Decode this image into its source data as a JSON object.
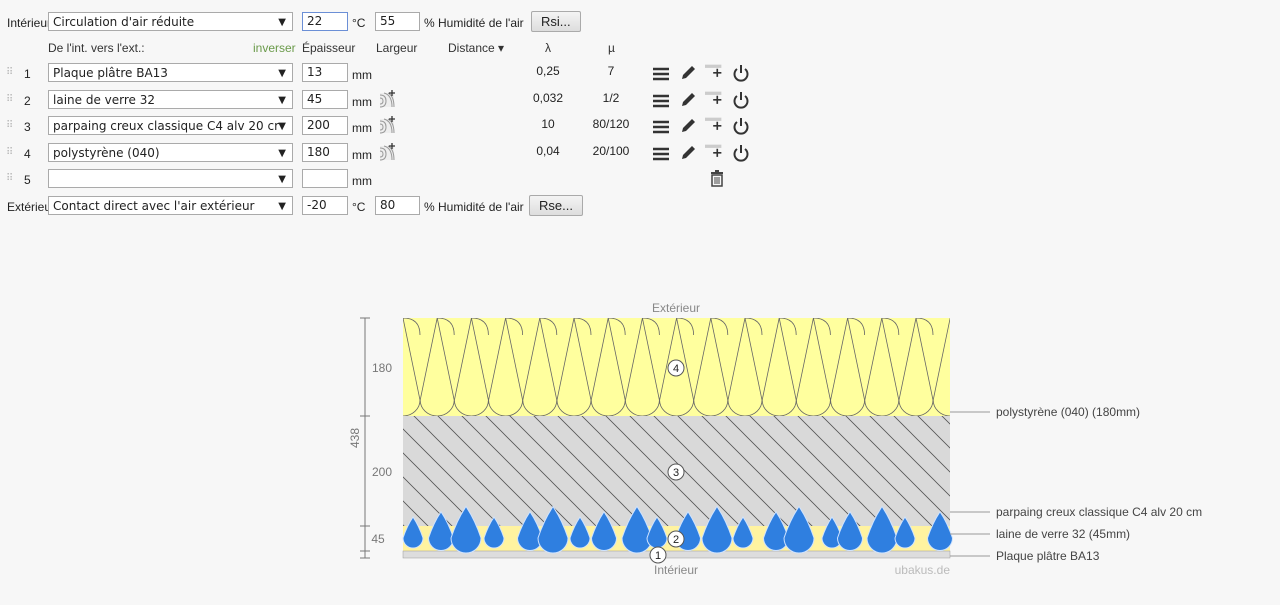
{
  "interior": {
    "label": "Intérieur",
    "condition": "Circulation d'air réduite",
    "temp": "22",
    "temp_unit": "°C",
    "humidity": "55",
    "humidity_label": "% Humidité de l'air",
    "button": "Rsi..."
  },
  "headers": {
    "direction": "De l'int. vers l'ext.:",
    "reverse": "inverser",
    "thickness": "Épaisseur",
    "width": "Largeur",
    "distance": "Distance ▾",
    "lambda": "λ",
    "mu": "µ"
  },
  "layers": [
    {
      "num": "1",
      "material": "Plaque plâtre BA13",
      "thickness": "13",
      "unit": "mm",
      "lambda": "0,25",
      "mu": "7"
    },
    {
      "num": "2",
      "material": "laine de verre 32",
      "thickness": "45",
      "unit": "mm",
      "lambda": "0,032",
      "mu": "1/2"
    },
    {
      "num": "3",
      "material": "parpaing creux classique C4 alv 20 cr",
      "thickness": "200",
      "unit": "mm",
      "lambda": "10",
      "mu": "80/120"
    },
    {
      "num": "4",
      "material": "polystyrène (040)",
      "thickness": "180",
      "unit": "mm",
      "lambda": "0,04",
      "mu": "20/100"
    },
    {
      "num": "5",
      "material": "",
      "thickness": "",
      "unit": "mm"
    }
  ],
  "exterior": {
    "label": "Extérieur",
    "condition": "Contact direct avec l'air extérieur",
    "temp": "-20",
    "temp_unit": "°C",
    "humidity": "80",
    "humidity_label": "% Humidité de l'air",
    "button": "Rse..."
  },
  "diagram": {
    "top_label": "Extérieur",
    "bottom_label": "Intérieur",
    "watermark": "ubakus.de",
    "total": "438",
    "dims": [
      "180",
      "200",
      "45"
    ],
    "callouts": [
      "polystyrène (040) (180mm)",
      "parpaing creux classique C4 alv 20 cm",
      "laine de verre 32 (45mm)",
      "Plaque plâtre BA13"
    ],
    "colors": {
      "polystyrene": "#ffff9e",
      "parpaing": "#d9d9d9",
      "laine": "#fff3a0",
      "drops": "#2f7fe0"
    }
  }
}
